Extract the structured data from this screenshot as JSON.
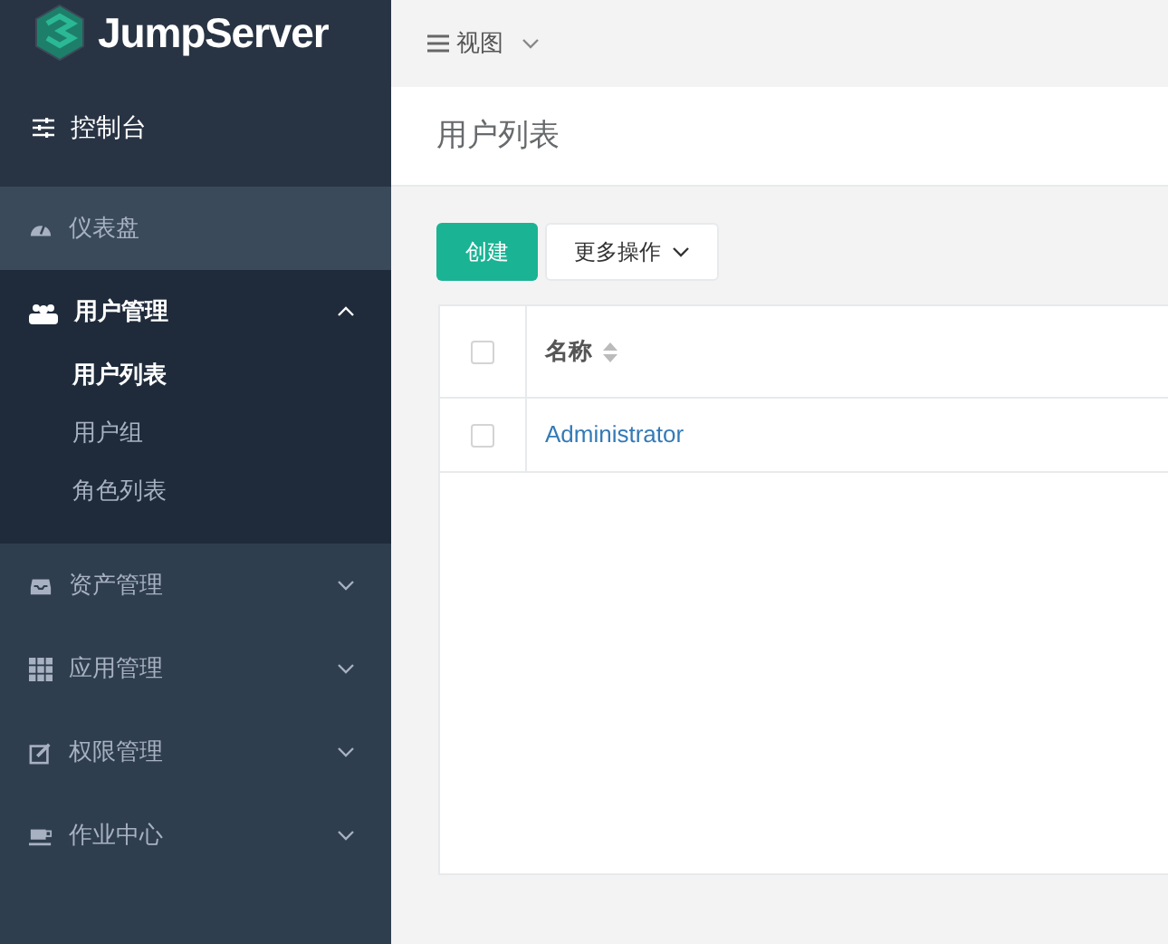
{
  "brand": {
    "name": "JumpServer"
  },
  "console": {
    "label": "控制台"
  },
  "nav": [
    {
      "kind": "link",
      "label": "仪表盘",
      "hovered": true,
      "expanded": false
    },
    {
      "kind": "group",
      "label": "用户管理",
      "hovered": false,
      "expanded": true,
      "children": [
        {
          "label": "用户列表",
          "selected": true
        },
        {
          "label": "用户组",
          "selected": false
        },
        {
          "label": "角色列表",
          "selected": false
        }
      ]
    },
    {
      "kind": "group",
      "label": "资产管理",
      "hovered": false,
      "expanded": false
    },
    {
      "kind": "group",
      "label": "应用管理",
      "hovered": false,
      "expanded": false
    },
    {
      "kind": "group",
      "label": "权限管理",
      "hovered": false,
      "expanded": false
    },
    {
      "kind": "group",
      "label": "作业中心",
      "hovered": false,
      "expanded": false
    }
  ],
  "topbar": {
    "view_menu": "视图"
  },
  "page_title": "用户列表",
  "actions": {
    "create": "创建",
    "more": "更多操作"
  },
  "table": {
    "select_all_checked": false,
    "columns": [
      {
        "label": "名称",
        "sortable": true
      }
    ],
    "rows": [
      {
        "checked": false,
        "name": "Administrator"
      }
    ]
  }
}
